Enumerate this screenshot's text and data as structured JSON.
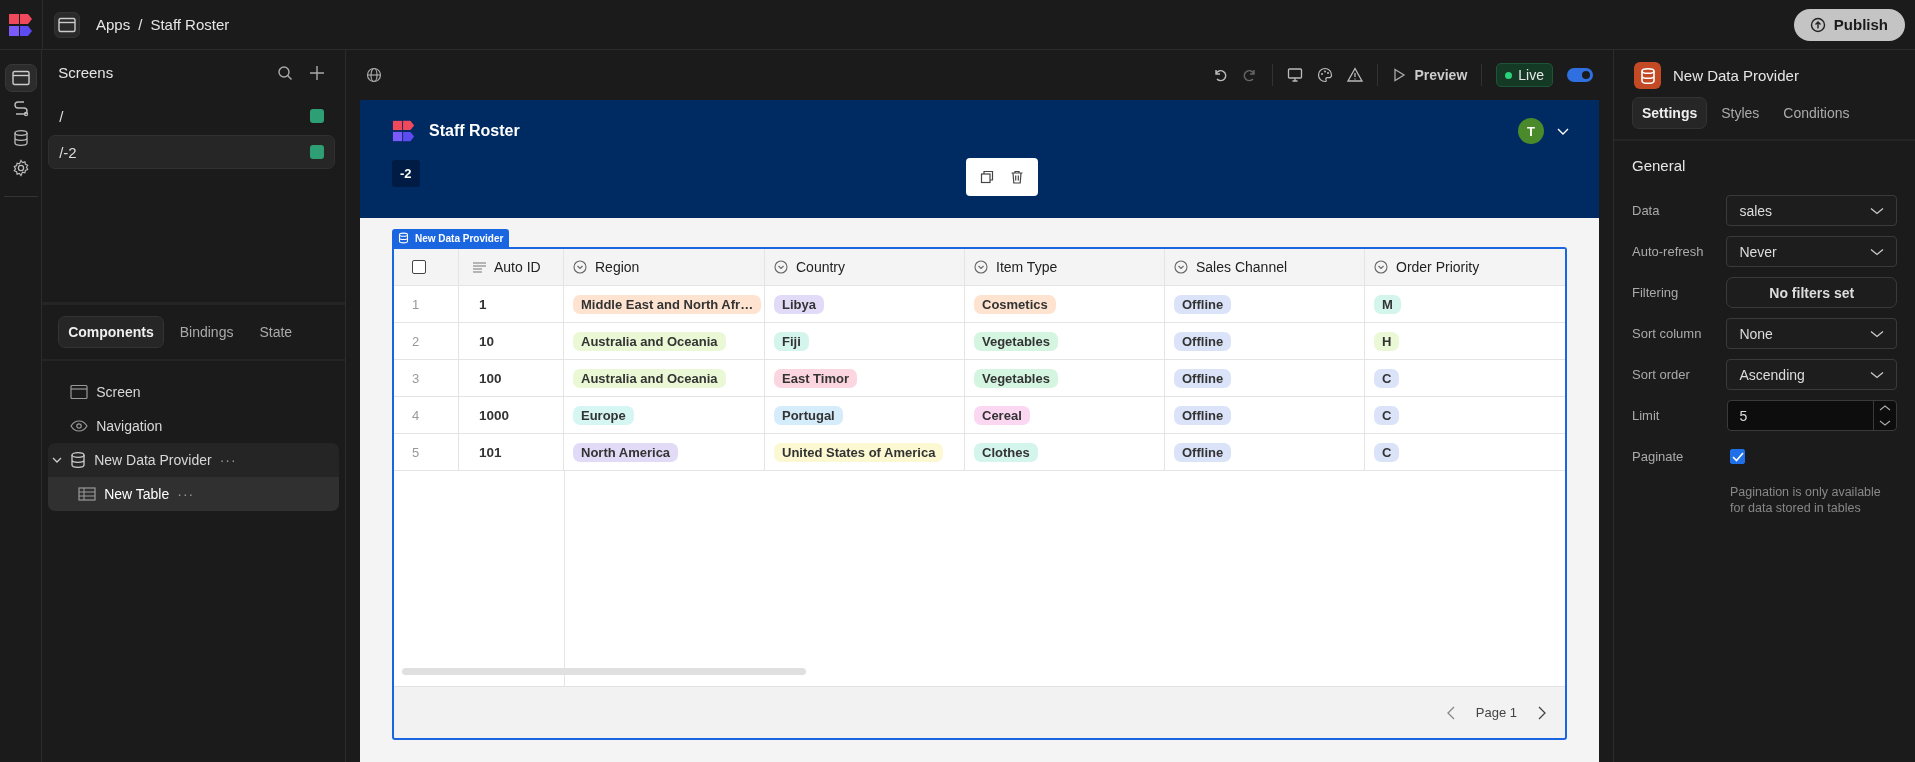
{
  "topbar": {
    "crumbs": [
      "Apps",
      "Staff Roster"
    ],
    "separator": "/",
    "publish": "Publish"
  },
  "rail": [
    {
      "kind": "screen",
      "selected": true
    },
    {
      "kind": "route",
      "selected": false
    },
    {
      "kind": "database",
      "selected": false
    },
    {
      "kind": "settings",
      "selected": false
    }
  ],
  "screens": {
    "title": "Screens",
    "items": [
      {
        "label": "/",
        "selected": false
      },
      {
        "label": "/-2",
        "selected": true
      }
    ]
  },
  "component_tabs": [
    {
      "label": "Components",
      "selected": true
    },
    {
      "label": "Bindings",
      "selected": false
    },
    {
      "label": "State",
      "selected": false
    }
  ],
  "tree": [
    {
      "label": "Screen",
      "kind": "screen",
      "selected": false
    },
    {
      "label": "Navigation",
      "kind": "navigation",
      "selected": false
    },
    {
      "label": "New Data Provider",
      "kind": "provider",
      "selected": false,
      "expanded": true,
      "more": "···",
      "children": [
        {
          "label": "New Table",
          "kind": "table",
          "selected": true,
          "more": "···"
        }
      ]
    }
  ],
  "toolbar": {
    "preview": "Preview",
    "live": "Live",
    "live_on": true
  },
  "app": {
    "title": "Staff Roster",
    "avatar": "T",
    "nav_item": "-2"
  },
  "provider_label": "New Data Provider",
  "table": {
    "select_all": false,
    "columns": [
      {
        "label": "Auto ID",
        "kind": "text"
      },
      {
        "label": "Region",
        "kind": "option"
      },
      {
        "label": "Country",
        "kind": "option"
      },
      {
        "label": "Item Type",
        "kind": "option"
      },
      {
        "label": "Sales Channel",
        "kind": "option"
      },
      {
        "label": "Order Priority",
        "kind": "option"
      }
    ],
    "rows": [
      {
        "number": "1",
        "cells": [
          {
            "text": "1"
          },
          {
            "text": "Middle East and North Afr…",
            "color": "#fde3d0"
          },
          {
            "text": "Libya",
            "color": "#e2dbf8"
          },
          {
            "text": "Cosmetics",
            "color": "#fde3d0"
          },
          {
            "text": "Offline",
            "color": "#dae3f8"
          },
          {
            "text": "M",
            "color": "#d4f5ec"
          }
        ]
      },
      {
        "number": "2",
        "cells": [
          {
            "text": "10"
          },
          {
            "text": "Australia and Oceania",
            "color": "#eaf8d6"
          },
          {
            "text": "Fiji",
            "color": "#d4f5ec"
          },
          {
            "text": "Vegetables",
            "color": "#d4f5e0"
          },
          {
            "text": "Offline",
            "color": "#dae3f8"
          },
          {
            "text": "H",
            "color": "#eaf8d6"
          }
        ]
      },
      {
        "number": "3",
        "cells": [
          {
            "text": "100"
          },
          {
            "text": "Australia and Oceania",
            "color": "#eaf8d6"
          },
          {
            "text": "East Timor",
            "color": "#fbd5e0"
          },
          {
            "text": "Vegetables",
            "color": "#d4f5e0"
          },
          {
            "text": "Offline",
            "color": "#dae3f8"
          },
          {
            "text": "C",
            "color": "#dae3f8"
          }
        ]
      },
      {
        "number": "4",
        "cells": [
          {
            "text": "1000"
          },
          {
            "text": "Europe",
            "color": "#d6f6f3"
          },
          {
            "text": "Portugal",
            "color": "#d5ecfa"
          },
          {
            "text": "Cereal",
            "color": "#fbd7f2"
          },
          {
            "text": "Offline",
            "color": "#dae3f8"
          },
          {
            "text": "C",
            "color": "#dae3f8"
          }
        ]
      },
      {
        "number": "5",
        "cells": [
          {
            "text": "101"
          },
          {
            "text": "North America",
            "color": "#e2dbf8"
          },
          {
            "text": "United States of America",
            "color": "#fbf8d2"
          },
          {
            "text": "Clothes",
            "color": "#d4f5ec"
          },
          {
            "text": "Offline",
            "color": "#dae3f8"
          },
          {
            "text": "C",
            "color": "#dae3f8"
          }
        ]
      }
    ],
    "page": "Page 1"
  },
  "inspector": {
    "title": "New Data Provider",
    "tabs": [
      {
        "label": "Settings",
        "selected": true
      },
      {
        "label": "Styles",
        "selected": false
      },
      {
        "label": "Conditions",
        "selected": false
      }
    ],
    "section": "General",
    "fields": [
      {
        "label": "Data",
        "kind": "select",
        "value": "sales"
      },
      {
        "label": "Auto-refresh",
        "kind": "select",
        "value": "Never"
      },
      {
        "label": "Filtering",
        "kind": "button",
        "value": "No filters set"
      },
      {
        "label": "Sort column",
        "kind": "select",
        "value": "None"
      },
      {
        "label": "Sort order",
        "kind": "select",
        "value": "Ascending"
      },
      {
        "label": "Limit",
        "kind": "number",
        "value": "5"
      },
      {
        "label": "Paginate",
        "kind": "checkbox",
        "checked": true
      }
    ],
    "note": "Pagination is only available for data stored in tables"
  }
}
